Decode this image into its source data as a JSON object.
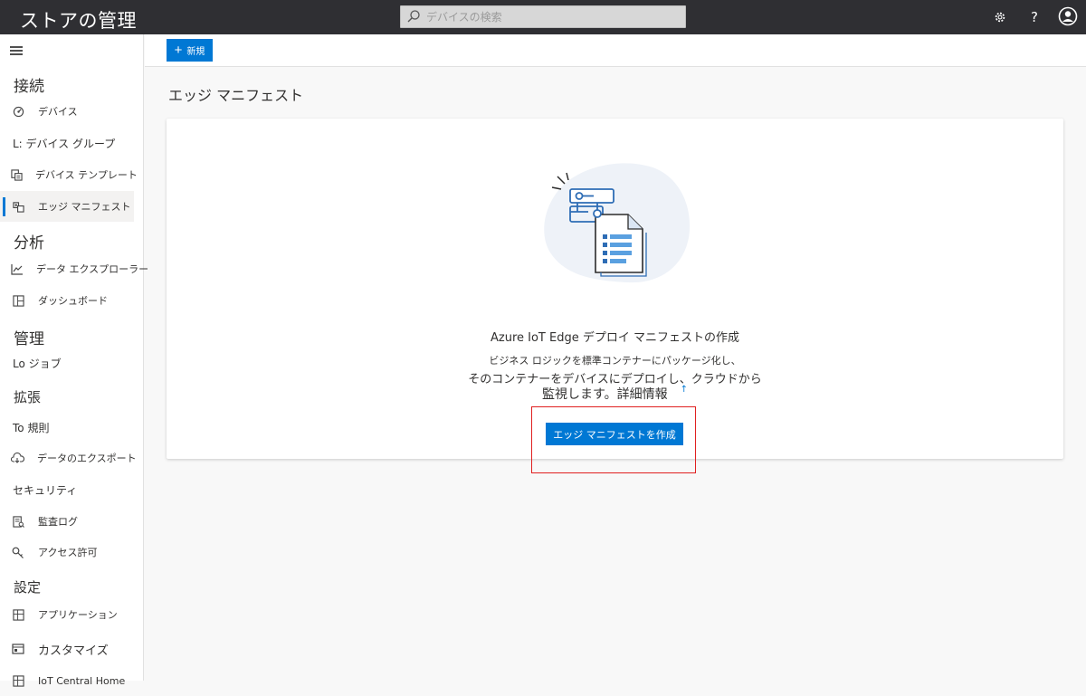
{
  "app": {
    "title": "ストアの管理"
  },
  "search": {
    "placeholder": "デバイスの検索"
  },
  "header_icons": [
    "gear-icon",
    "help-icon",
    "account-icon"
  ],
  "header": {
    "help_label": "?"
  },
  "sidebar": {
    "sections": {
      "connect": "接続",
      "analyze": "分析",
      "manage": "管理",
      "extend": "拡張",
      "settings": "設定"
    },
    "items": {
      "devices": "デバイス",
      "device_groups": "L: デバイス グループ",
      "device_templates": "デバイス テンプレート",
      "edge_manifests": "エッジ マニフェスト",
      "data_explorer": "データ エクスプローラー",
      "dashboards": "ダッシュボード",
      "jobs": "Lo ジョブ",
      "rules": "To 規則",
      "data_export": "データのエクスポート",
      "security": "セキュリティ",
      "audit_logs": "監査ログ",
      "permissions": "アクセス許可",
      "applications": "アプリケーション",
      "customize": "カスタマイズ",
      "iot_central_home": "IoT Central Home"
    }
  },
  "toolbar": {
    "new_label": "新規"
  },
  "page": {
    "title": "エッジ マニフェスト",
    "empty_state": {
      "title": "Azure IoT Edge デプロイ マニフェストの作成",
      "desc_line1": "ビジネス ロジックを標準コンテナーにパッケージ化し、",
      "desc_line2": "そのコンテナーをデバイスにデプロイし、クラウドから",
      "desc_line3": "監視します。",
      "learn_more": "詳細情報",
      "button": "エッジ マニフェストを作成"
    }
  },
  "colors": {
    "accent": "#0078d4",
    "topbar": "#2f2f33",
    "highlight": "#e02020"
  }
}
